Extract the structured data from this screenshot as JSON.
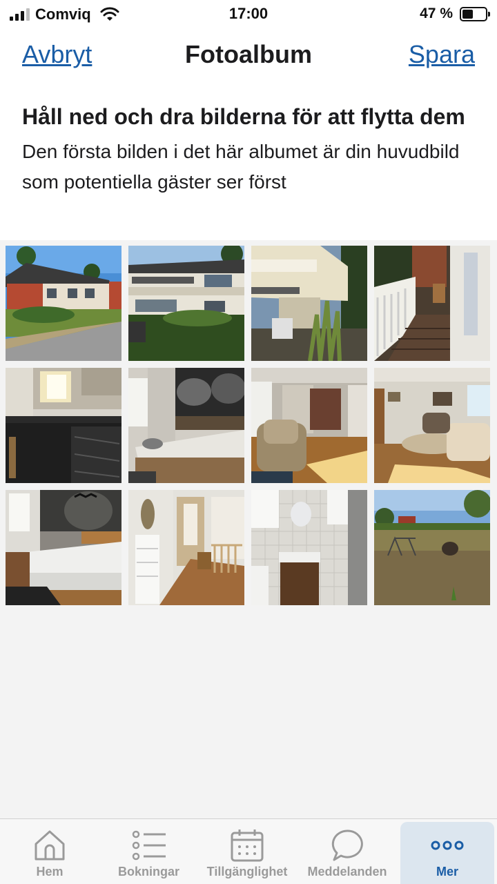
{
  "status_bar": {
    "carrier": "Comviq",
    "time": "17:00",
    "battery_percent": "47 %",
    "battery_level": 0.47
  },
  "nav": {
    "cancel_label": "Avbryt",
    "title": "Fotoalbum",
    "save_label": "Spara"
  },
  "intro": {
    "heading": "Håll ned och dra bilderna för att flytta dem",
    "description": "Den första bilden i det här albumet är din huvudbild som potentiella gäster ser först"
  },
  "photos": [
    {
      "subject": "house-exterior-red-brick"
    },
    {
      "subject": "house-exterior-balcony"
    },
    {
      "subject": "house-side-yard"
    },
    {
      "subject": "balcony-deck"
    },
    {
      "subject": "kitchen"
    },
    {
      "subject": "bedroom-wall-mural"
    },
    {
      "subject": "living-room-armchair"
    },
    {
      "subject": "living-room-sofa"
    },
    {
      "subject": "bedroom"
    },
    {
      "subject": "hallway"
    },
    {
      "subject": "bathroom"
    },
    {
      "subject": "garden-playground"
    }
  ],
  "tab_bar": {
    "active": "Mer",
    "tabs": [
      {
        "label": "Hem",
        "icon": "home-icon"
      },
      {
        "label": "Bokningar",
        "icon": "list-icon"
      },
      {
        "label": "Tillgänglighet",
        "icon": "calendar-icon"
      },
      {
        "label": "Meddelanden",
        "icon": "chat-bubble-icon"
      },
      {
        "label": "Mer",
        "icon": "more-dots-icon"
      }
    ]
  },
  "colors": {
    "accent": "#1a5da6",
    "inactive_tab": "#9a9a9a",
    "background": "#f3f3f3"
  }
}
